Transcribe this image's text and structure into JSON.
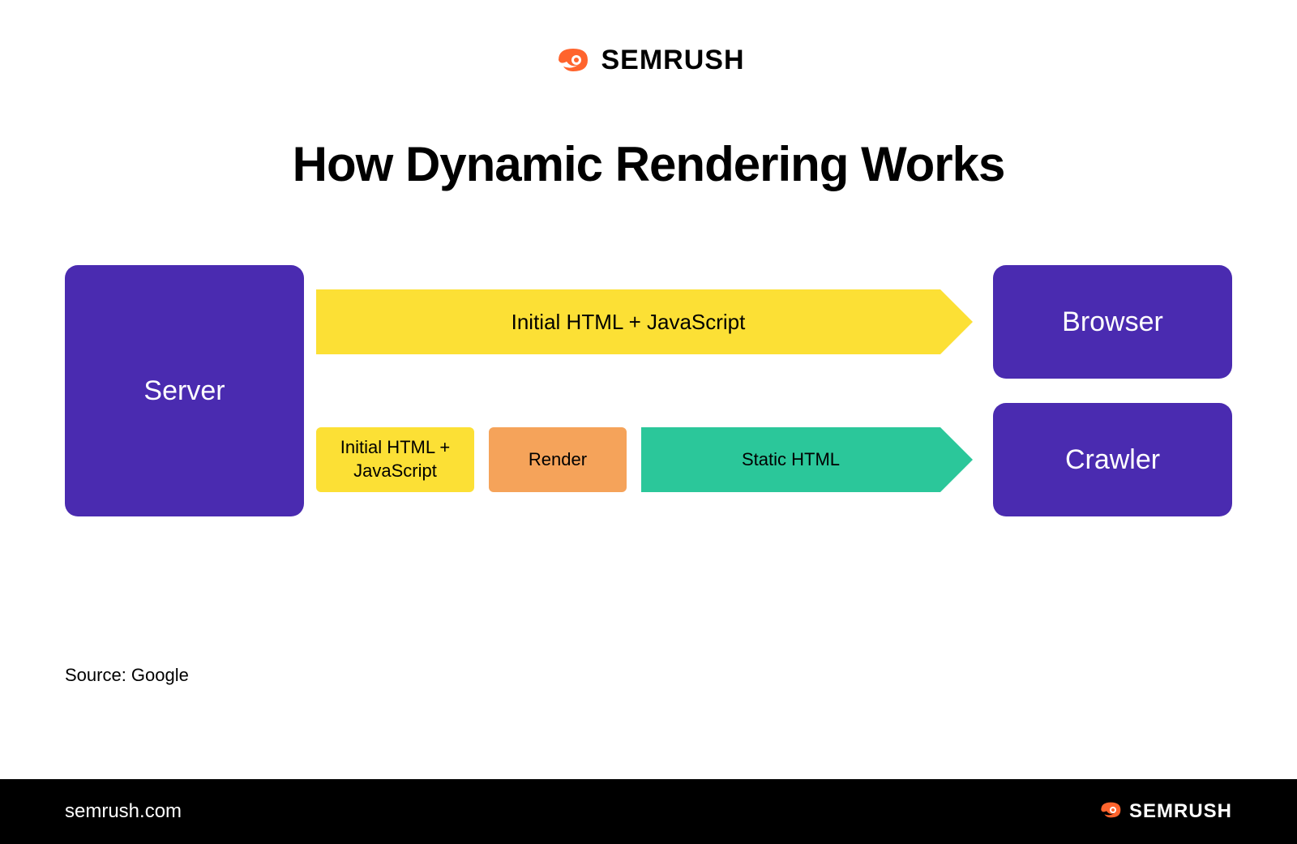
{
  "header": {
    "brand_name": "SEMRUSH"
  },
  "title": "How Dynamic Rendering Works",
  "diagram": {
    "server_label": "Server",
    "browser_label": "Browser",
    "crawler_label": "Crawler",
    "arrow_top_label": "Initial HTML + JavaScript",
    "step1_label": "Initial HTML + JavaScript",
    "step2_label": "Render",
    "step3_label": "Static HTML"
  },
  "source_text": "Source: Google",
  "footer": {
    "url": "semrush.com",
    "brand_name": "SEMRUSH"
  },
  "colors": {
    "purple": "#4a2bb0",
    "yellow": "#fce035",
    "orange": "#f5a35a",
    "green": "#2bc79a",
    "brand_orange": "#ff642d"
  }
}
